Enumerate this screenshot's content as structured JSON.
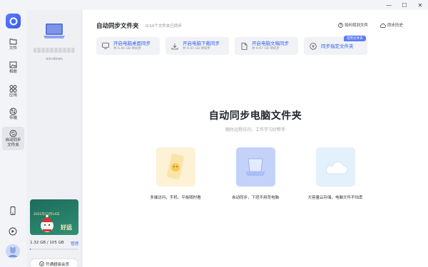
{
  "window": {
    "minimize": "—",
    "maximize": "☐",
    "close": "✕"
  },
  "rail": {
    "items": [
      {
        "label": "文件",
        "icon": "folder-icon"
      },
      {
        "label": "相册",
        "icon": "photo-icon"
      },
      {
        "label": "应用",
        "icon": "apps-icon"
      },
      {
        "label": "传输",
        "icon": "transfer-icon"
      },
      {
        "label": "自动同步\n文件夹",
        "icon": "sync-icon"
      }
    ]
  },
  "device": {
    "os": "windows"
  },
  "promo": {
    "date": "2022年12月14日",
    "text": "好运"
  },
  "storage": {
    "used": "1.32 GB / 105 GB",
    "manage": "管理",
    "fraction": 0.013
  },
  "vip": {
    "label": "开通超级会员"
  },
  "header": {
    "title": "自动同步文件夹",
    "subtitle": "0/10个文件夹已同步",
    "help": "如何找到文件",
    "history": "同步历史"
  },
  "sync_cards": [
    {
      "title": "开启电脑桌面同步",
      "sub": "共 6.46 GB 待同步",
      "icon": "desktop-icon"
    },
    {
      "title": "开启电脑下载同步",
      "sub": "共 9.45 GB 待同步",
      "icon": "download-icon"
    },
    {
      "title": "开启电脑文稿同步",
      "sub": "共 9.97 GB 待同步",
      "icon": "document-icon"
    },
    {
      "title": "同步指定文件夹",
      "sub": "",
      "icon": "plus-circle-icon"
    }
  ],
  "badge": "常用文件夹",
  "hero": {
    "title": "自动同步电脑文件夹",
    "subtitle": "随时远程访问，工作学习好帮手"
  },
  "features": [
    {
      "label": "多端访问，手机、平板随时看"
    },
    {
      "label": "自动同步，下班不用背电脑"
    },
    {
      "label": "大容量云存储，电脑文件不怕丢"
    }
  ],
  "colors": {
    "accent": "#2b5ff0",
    "rail_bg": "#f3f4f7",
    "main_bg": "#ffffff"
  }
}
